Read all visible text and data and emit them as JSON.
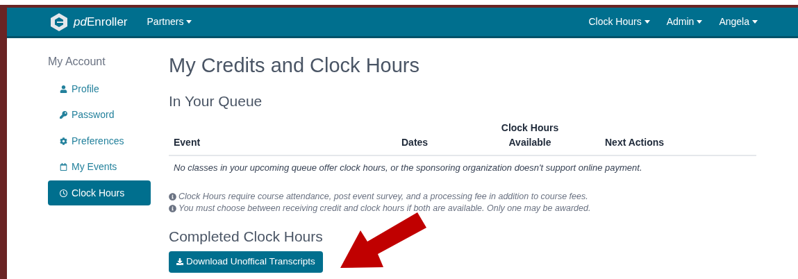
{
  "navbar": {
    "brand": {
      "prefix": "pd",
      "name": "Enroller"
    },
    "left_menu": [
      {
        "label": "Partners"
      }
    ],
    "right_menu": [
      {
        "label": "Clock Hours"
      },
      {
        "label": "Admin"
      },
      {
        "label": "Angela"
      }
    ]
  },
  "sidebar": {
    "title": "My Account",
    "items": [
      {
        "label": "Profile",
        "kind": "user",
        "selected": false
      },
      {
        "label": "Password",
        "kind": "key",
        "selected": false
      },
      {
        "label": "Preferences",
        "kind": "gear",
        "selected": false
      },
      {
        "label": "My Events",
        "kind": "calendar",
        "selected": false
      },
      {
        "label": "Clock Hours",
        "kind": "clock",
        "selected": true
      }
    ]
  },
  "page_title": "My Credits and Clock Hours",
  "queue": {
    "heading": "In Your Queue",
    "table": {
      "columns": [
        "Event",
        "Dates",
        "Clock Hours Available",
        "Next Actions"
      ],
      "empty_message": "No classes in your upcoming queue offer clock hours, or the sponsoring organization doesn't support online payment."
    }
  },
  "notes": [
    "Clock Hours require course attendance, post event survey, and a processing fee in addition to course fees.",
    "You must choose between receiving credit and clock hours if both are available. Only one may be awarded."
  ],
  "completed": {
    "heading": "Completed Clock Hours",
    "button": "Download Unoffical Transcripts"
  }
}
